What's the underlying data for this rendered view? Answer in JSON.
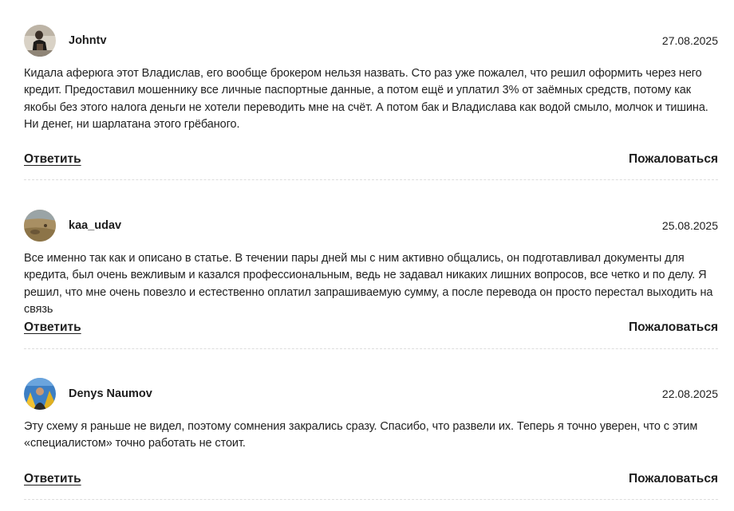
{
  "comments": [
    {
      "author": "Johntv",
      "date": "27.08.2025",
      "text": "Кидала аферюга этот Владислав, его вообще брокером нельзя назвать. Сто раз уже пожалел, что решил оформить через него кредит. Предоставил мошеннику все личные паспортные данные, а потом ещё и уплатил 3% от заёмных средств, потому как якобы без этого налога деньги не хотели переводить мне на счёт. А потом бак и Владислава как водой смыло, молчок и тишина. Ни денег, ни шарлатана этого грёбаного.",
      "reply_label": "Ответить",
      "report_label": "Пожаловаться"
    },
    {
      "author": "kaa_udav",
      "date": "25.08.2025",
      "text": "Все именно так как и описано в статье. В течении пары дней мы с ним активно общались, он подготавливал документы для кредита, был очень вежливым и казался профессиональным, ведь не задавал никаких лишних вопросов, все четко и по делу. Я решил, что мне очень повезло и естественно оплатил запрашиваемую сумму, а после перевода он просто перестал выходить на связь",
      "reply_label": "Ответить",
      "report_label": "Пожаловаться"
    },
    {
      "author": "Denys Naumov",
      "date": "22.08.2025",
      "text": "Эту схему я раньше не видел, поэтому сомнения закрались сразу. Спасибо, что развели их. Теперь я точно уверен, что с этим «специалистом» точно работать не стоит.",
      "reply_label": "Ответить",
      "report_label": "Пожаловаться"
    }
  ]
}
